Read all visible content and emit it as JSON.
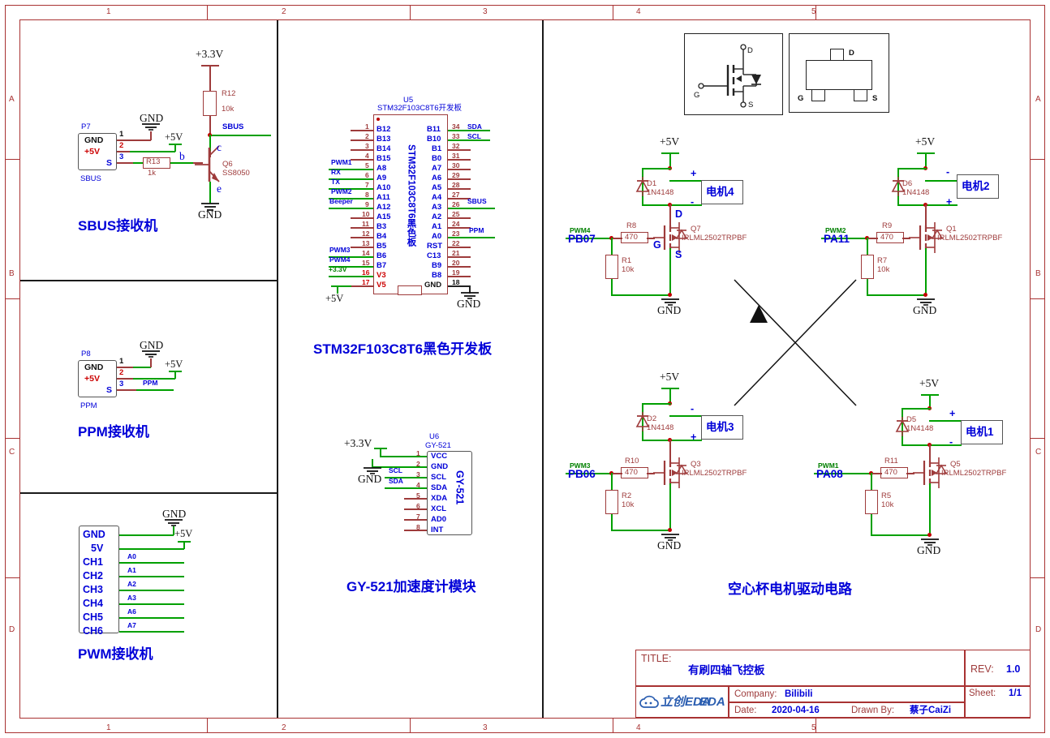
{
  "sheet": {
    "zone_cols": [
      "1",
      "2",
      "3",
      "4",
      "5"
    ],
    "zone_rows": [
      "A",
      "B",
      "C",
      "D"
    ]
  },
  "title_block": {
    "title_label": "TITLE:",
    "title_value": "有刷四轴飞控板",
    "rev_label": "REV:",
    "rev_value": "1.0",
    "sheet_label": "Sheet:",
    "sheet_value": "1/1",
    "company_label": "Company:",
    "company_value": "Bilibili",
    "date_label": "Date:",
    "date_value": "2020-04-16",
    "drawn_label": "Drawn By:",
    "drawn_value": "蔡子CaiZi",
    "logo_text": "立创EDA"
  },
  "sbus": {
    "caption": "SBUS接收机",
    "ref": "P7",
    "conn_name": "SBUS",
    "pins": [
      {
        "num": "1",
        "name": "GND"
      },
      {
        "num": "2",
        "name": "+5V"
      },
      {
        "num": "3",
        "name": "S"
      }
    ],
    "power_33": "+3.3V",
    "power_5v": "+5V",
    "gnd_top": "GND",
    "gnd_bottom": "GND",
    "r12_ref": "R12",
    "r12_val": "10k",
    "r13_ref": "R13",
    "r13_val": "1k",
    "net_sbus": "SBUS",
    "q_ref": "Q6",
    "q_part": "SS8050",
    "term_b": "b",
    "term_c": "c",
    "term_e": "e"
  },
  "ppm": {
    "caption": "PPM接收机",
    "ref": "P8",
    "conn_name": "PPM",
    "pins": [
      {
        "num": "1",
        "name": "GND"
      },
      {
        "num": "2",
        "name": "+5V"
      },
      {
        "num": "3",
        "name": "S"
      }
    ],
    "gnd": "GND",
    "power_5v": "+5V",
    "net_ppm": "PPM"
  },
  "pwm_rx": {
    "caption": "PWM接收机",
    "gnd": "GND",
    "power_5v": "+5V",
    "pins": [
      "GND",
      "5V",
      "CH1",
      "CH2",
      "CH3",
      "CH4",
      "CH5",
      "CH6"
    ],
    "nets": [
      "A0",
      "A1",
      "A2",
      "A3",
      "A6",
      "A7"
    ]
  },
  "mcu": {
    "caption": "STM32F103C8T6黑色开发板",
    "ref": "U5",
    "part": "STM32F103C8T6开发板",
    "body_text": "STM32F103C8T6黑色板",
    "power_5v": "+5V",
    "gnd": "GND",
    "left_pins": [
      {
        "num": "1",
        "name": "B12",
        "net": ""
      },
      {
        "num": "2",
        "name": "B13",
        "net": ""
      },
      {
        "num": "3",
        "name": "B14",
        "net": ""
      },
      {
        "num": "4",
        "name": "B15",
        "net": ""
      },
      {
        "num": "5",
        "name": "A8",
        "net": "PWM1"
      },
      {
        "num": "6",
        "name": "A9",
        "net": "RX"
      },
      {
        "num": "7",
        "name": "A10",
        "net": "TX"
      },
      {
        "num": "8",
        "name": "A11",
        "net": "PWM2"
      },
      {
        "num": "9",
        "name": "A12",
        "net": "Beeper"
      },
      {
        "num": "10",
        "name": "A15",
        "net": ""
      },
      {
        "num": "11",
        "name": "B3",
        "net": ""
      },
      {
        "num": "12",
        "name": "B4",
        "net": ""
      },
      {
        "num": "13",
        "name": "B5",
        "net": ""
      },
      {
        "num": "14",
        "name": "B6",
        "net": "PWM3"
      },
      {
        "num": "15",
        "name": "B7",
        "net": "PWM4"
      },
      {
        "num": "16",
        "name": "V3",
        "net": "+3.3V"
      },
      {
        "num": "17",
        "name": "V5",
        "net": ""
      }
    ],
    "right_pins": [
      {
        "num": "34",
        "name": "B11",
        "net": "SDA"
      },
      {
        "num": "33",
        "name": "B10",
        "net": "SCL"
      },
      {
        "num": "32",
        "name": "B1",
        "net": ""
      },
      {
        "num": "31",
        "name": "B0",
        "net": ""
      },
      {
        "num": "30",
        "name": "A7",
        "net": ""
      },
      {
        "num": "29",
        "name": "A6",
        "net": ""
      },
      {
        "num": "28",
        "name": "A5",
        "net": ""
      },
      {
        "num": "27",
        "name": "A4",
        "net": ""
      },
      {
        "num": "26",
        "name": "A3",
        "net": "SBUS"
      },
      {
        "num": "25",
        "name": "A2",
        "net": ""
      },
      {
        "num": "24",
        "name": "A1",
        "net": ""
      },
      {
        "num": "23",
        "name": "A0",
        "net": "PPM"
      },
      {
        "num": "22",
        "name": "RST",
        "net": ""
      },
      {
        "num": "21",
        "name": "C13",
        "net": ""
      },
      {
        "num": "20",
        "name": "B9",
        "net": ""
      },
      {
        "num": "19",
        "name": "B8",
        "net": ""
      },
      {
        "num": "18",
        "name": "GND",
        "net": ""
      }
    ]
  },
  "gy521": {
    "caption": "GY-521加速度计模块",
    "ref": "U6",
    "part": "GY-521",
    "body_text": "GY-521",
    "power_33": "+3.3V",
    "gnd": "GND",
    "pins": [
      {
        "num": "1",
        "name": "VCC",
        "net": ""
      },
      {
        "num": "2",
        "name": "GND",
        "net": ""
      },
      {
        "num": "3",
        "name": "SCL",
        "net": "SCL"
      },
      {
        "num": "4",
        "name": "SDA",
        "net": "SDA"
      },
      {
        "num": "5",
        "name": "XDA",
        "net": ""
      },
      {
        "num": "6",
        "name": "XCL",
        "net": ""
      },
      {
        "num": "7",
        "name": "AD0",
        "net": ""
      },
      {
        "num": "8",
        "name": "INT",
        "net": ""
      }
    ]
  },
  "motor_section": {
    "caption": "空心杯电机驱动电路",
    "symbol_pins": {
      "d": "D",
      "g": "G",
      "s": "S"
    },
    "motors": [
      {
        "id": "m4",
        "label": "电机4",
        "power": "+5V",
        "gnd": "GND",
        "diode_ref": "D1",
        "diode_part": "1N4148",
        "gate_res_ref": "R8",
        "gate_res_val": "470",
        "pull_res_ref": "R1",
        "pull_res_val": "10k",
        "fet_ref": "Q7",
        "fet_part": "IRLML2502TRPBF",
        "net": "PWM4",
        "port": "PB07",
        "top_polarity": "+",
        "bottom_polarity": "-",
        "show_dgs": true,
        "d": "D",
        "g": "G",
        "s": "S"
      },
      {
        "id": "m2",
        "label": "电机2",
        "power": "+5V",
        "gnd": "GND",
        "diode_ref": "D6",
        "diode_part": "1N4148",
        "gate_res_ref": "R9",
        "gate_res_val": "470",
        "pull_res_ref": "R7",
        "pull_res_val": "10k",
        "fet_ref": "Q1",
        "fet_part": "IRLML2502TRPBF",
        "net": "PWM2",
        "port": "PA11",
        "top_polarity": "-",
        "bottom_polarity": "+",
        "show_dgs": false
      },
      {
        "id": "m3",
        "label": "电机3",
        "power": "+5V",
        "gnd": "GND",
        "diode_ref": "D2",
        "diode_part": "1N4148",
        "gate_res_ref": "R10",
        "gate_res_val": "470",
        "pull_res_ref": "R2",
        "pull_res_val": "10k",
        "fet_ref": "Q3",
        "fet_part": "IRLML2502TRPBF",
        "net": "PWM3",
        "port": "PB06",
        "top_polarity": "-",
        "bottom_polarity": "+",
        "show_dgs": false
      },
      {
        "id": "m1",
        "label": "电机1",
        "power": "+5V",
        "gnd": "GND",
        "diode_ref": "D5",
        "diode_part": "1N4148",
        "gate_res_ref": "R11",
        "gate_res_val": "470",
        "pull_res_ref": "R5",
        "pull_res_val": "10k",
        "fet_ref": "Q5",
        "fet_part": "IRLML2502TRPBF",
        "net": "PWM1",
        "port": "PA08",
        "top_polarity": "+",
        "bottom_polarity": "-",
        "show_dgs": false
      }
    ]
  },
  "fet_symbols": {
    "schematic": {
      "d": "D",
      "g": "G",
      "s": "S"
    },
    "package": {
      "d": "D",
      "g": "G",
      "s": "S"
    }
  }
}
